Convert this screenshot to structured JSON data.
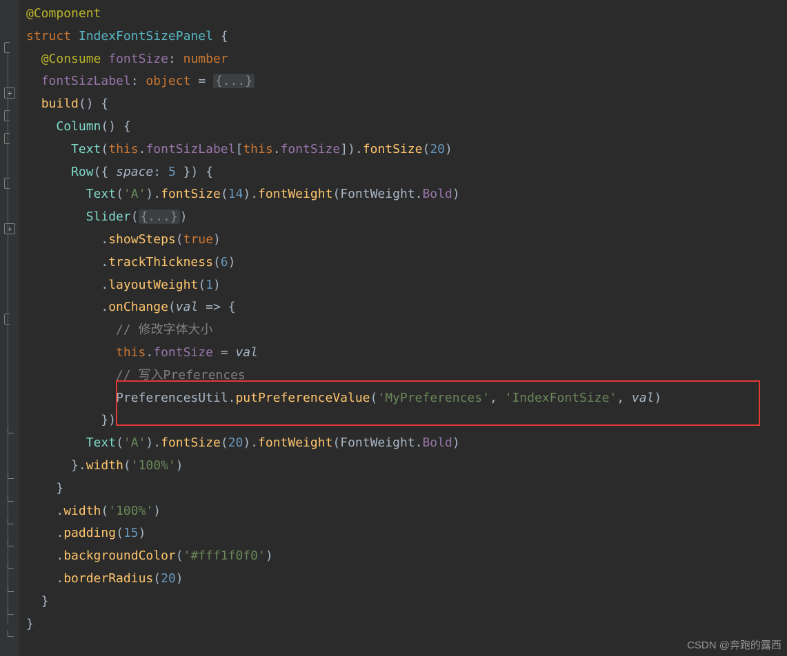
{
  "watermark": "CSDN @奔跑的露西",
  "code": {
    "l1": {
      "decorator": "@Component"
    },
    "l2": {
      "kw": "struct",
      "name": "IndexFontSizePanel",
      "brace": "{"
    },
    "l3": {
      "decorator": "@Consume",
      "prop": "fontSize",
      "colon": ": ",
      "type": "number"
    },
    "l4": {
      "prop": "fontSizLabel",
      "colon": ": ",
      "type": "object",
      "eq": " = ",
      "fold": "{...}"
    },
    "l5": {
      "fn": "build",
      "args": "()",
      "brace": " {"
    },
    "l6": {
      "fn": "Column",
      "args": "()",
      "brace": " {"
    },
    "l7": {
      "fn": "Text",
      "p": "(",
      "this": "this",
      "dot": ".",
      "a1": "fontSizLabel",
      "ob": "[",
      "this2": "this",
      "dot2": ".",
      "a2": "fontSize",
      "cb": "]",
      "cp": ")",
      "dot3": ".",
      "fn2": "fontSize",
      "p2": "(",
      "num": "20",
      "cp2": ")"
    },
    "l8": {
      "fn": "Row",
      "p": "({ ",
      "k": "space",
      "col": ": ",
      "num": "5",
      "cp": " }) ",
      "brace": "{"
    },
    "l9": {
      "fn": "Text",
      "p": "(",
      "str": "'A'",
      "cp": ")",
      "d1": ".",
      "fn2": "fontSize",
      "p2": "(",
      "num": "14",
      "cp2": ")",
      "d2": ".",
      "fn3": "fontWeight",
      "p3": "(",
      "cls": "FontWeight",
      "d3": ".",
      "prop": "Bold",
      "cp3": ")"
    },
    "l10": {
      "fn": "Slider",
      "p": "(",
      "fold": "{...}",
      "cp": ")"
    },
    "l11": {
      "d": ".",
      "fn": "showSteps",
      "p": "(",
      "kw": "true",
      "cp": ")"
    },
    "l12": {
      "d": ".",
      "fn": "trackThickness",
      "p": "(",
      "num": "6",
      "cp": ")"
    },
    "l13": {
      "d": ".",
      "fn": "layoutWeight",
      "p": "(",
      "num": "1",
      "cp": ")"
    },
    "l14": {
      "d": ".",
      "fn": "onChange",
      "p": "(",
      "param": "val",
      "arrow": " => ",
      "brace": "{"
    },
    "l15": {
      "comment": "// 修改字体大小"
    },
    "l16": {
      "this": "this",
      "d": ".",
      "prop": "fontSize",
      "eq": " = ",
      "var": "val"
    },
    "l17": {
      "comment": "// 写入Preferences"
    },
    "l18": {
      "cls": "PreferencesUtil",
      "d": ".",
      "fn": "putPreferenceValue",
      "p": "(",
      "s1": "'MyPreferences'",
      "c1": ", ",
      "s2": "'IndexFontSize'",
      "c2": ", ",
      "var": "val",
      "cp": ")"
    },
    "l19": {
      "brace": "})"
    },
    "l20": {
      "fn": "Text",
      "p": "(",
      "str": "'A'",
      "cp": ")",
      "d1": ".",
      "fn2": "fontSize",
      "p2": "(",
      "num": "20",
      "cp2": ")",
      "d2": ".",
      "fn3": "fontWeight",
      "p3": "(",
      "cls": "FontWeight",
      "d3": ".",
      "prop": "Bold",
      "cp3": ")"
    },
    "l21": {
      "brace": "}",
      "d": ".",
      "fn": "width",
      "p": "(",
      "str": "'100%'",
      "cp": ")"
    },
    "l22": {
      "brace": "}"
    },
    "l23": {
      "d": ".",
      "fn": "width",
      "p": "(",
      "str": "'100%'",
      "cp": ")"
    },
    "l24": {
      "d": ".",
      "fn": "padding",
      "p": "(",
      "num": "15",
      "cp": ")"
    },
    "l25": {
      "d": ".",
      "fn": "backgroundColor",
      "p": "(",
      "str": "'#fff1f0f0'",
      "cp": ")"
    },
    "l26": {
      "d": ".",
      "fn": "borderRadius",
      "p": "(",
      "num": "20",
      "cp": ")"
    },
    "l27": {
      "brace": "}"
    },
    "l28": {
      "brace": "}"
    }
  }
}
